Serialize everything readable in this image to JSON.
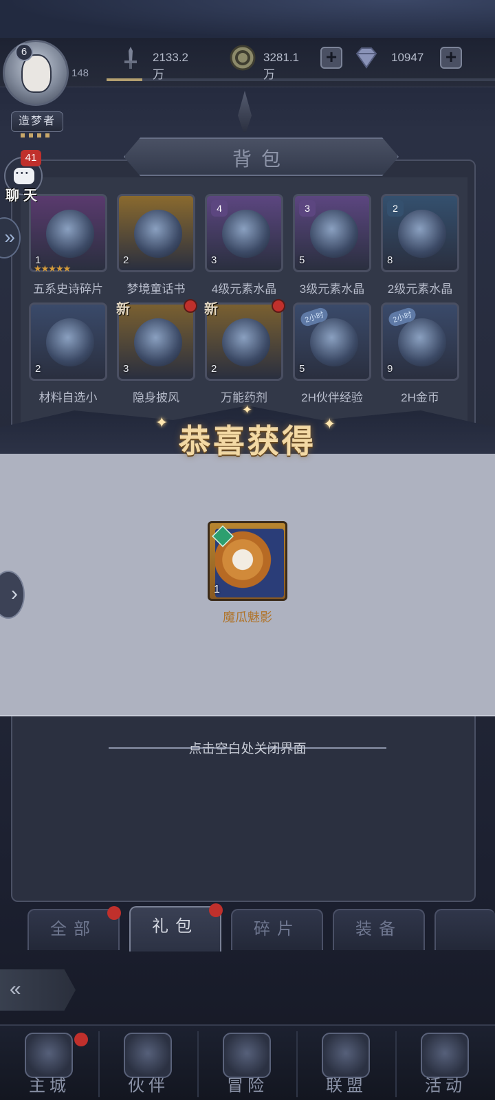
{
  "topbar": {
    "level": "6",
    "player_power": "148",
    "title_badge": "造梦者",
    "resources": [
      {
        "icon": "sword-icon",
        "value": "2133.2万"
      },
      {
        "icon": "gold-coin-icon",
        "value": "3281.1万"
      },
      {
        "icon": "diamond-icon",
        "value": "10947"
      }
    ]
  },
  "chat": {
    "badge": "41",
    "label": "聊天"
  },
  "bag": {
    "title": "背包",
    "items": [
      {
        "name": "五系史诗碎片",
        "count": "1",
        "grade": "",
        "stars": "★★★★★",
        "new": false,
        "time_tag": "",
        "color": "#5a3a6e"
      },
      {
        "name": "梦境童话书",
        "count": "2",
        "grade": "",
        "stars": "",
        "new": false,
        "time_tag": "",
        "color": "#8a6a2e"
      },
      {
        "name": "4级元素水晶",
        "count": "3",
        "grade": "4",
        "stars": "",
        "new": false,
        "time_tag": "",
        "color": "#5c4680"
      },
      {
        "name": "3级元素水晶",
        "count": "5",
        "grade": "3",
        "stars": "",
        "new": false,
        "time_tag": "",
        "color": "#5c4680"
      },
      {
        "name": "2级元素水晶",
        "count": "8",
        "grade": "2",
        "stars": "",
        "new": false,
        "time_tag": "",
        "color": "#34506e"
      },
      {
        "name": "材料自选小",
        "count": "2",
        "grade": "",
        "stars": "",
        "new": false,
        "time_tag": "",
        "color": "#3a4a6a"
      },
      {
        "name": "隐身披风",
        "count": "3",
        "grade": "",
        "stars": "",
        "new": true,
        "time_tag": "",
        "color": "#7a6030"
      },
      {
        "name": "万能药剂",
        "count": "2",
        "grade": "",
        "stars": "",
        "new": true,
        "time_tag": "",
        "color": "#7a6030"
      },
      {
        "name": "2H伙伴经验",
        "count": "5",
        "grade": "",
        "stars": "",
        "new": false,
        "time_tag": "2小时",
        "color": "#3a4a6a"
      },
      {
        "name": "2H金币",
        "count": "9",
        "grade": "",
        "stars": "",
        "new": false,
        "time_tag": "2小时",
        "color": "#3a4a6a"
      }
    ]
  },
  "reward": {
    "title": "恭喜获得",
    "item_name": "魔瓜魅影",
    "item_count": "1",
    "close_hint": "点击空白处关闭界面"
  },
  "tabs": [
    {
      "label": "全部",
      "active": false,
      "dot": true
    },
    {
      "label": "礼包",
      "active": true,
      "dot": true
    },
    {
      "label": "碎片",
      "active": false,
      "dot": false
    },
    {
      "label": "装备",
      "active": false,
      "dot": false
    }
  ],
  "nav": [
    {
      "label": "主城",
      "icon": "castle-icon",
      "dot": true
    },
    {
      "label": "伙伴",
      "icon": "witch-hat-icon",
      "dot": false
    },
    {
      "label": "冒险",
      "icon": "compass-icon",
      "dot": false
    },
    {
      "label": "联盟",
      "icon": "shield-icon",
      "dot": false
    },
    {
      "label": "活动",
      "icon": "cards-icon",
      "dot": false
    }
  ],
  "colors": {
    "reward_name": "#b0742a",
    "badge_red": "#c0302c",
    "reward_title_gold": "#f3d9a4"
  }
}
